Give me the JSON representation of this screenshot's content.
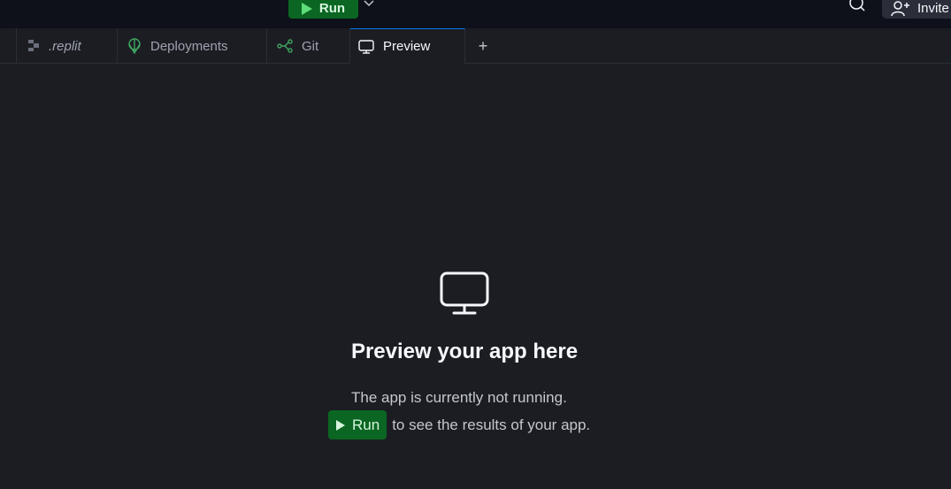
{
  "header": {
    "run_label": "Run",
    "invite_label": "Invite"
  },
  "tabs": [
    {
      "label": ".replit",
      "icon": "replit-file-icon"
    },
    {
      "label": "Deployments",
      "icon": "deployments-icon"
    },
    {
      "label": "Git",
      "icon": "git-icon"
    },
    {
      "label": "Preview",
      "icon": "monitor-icon",
      "active": true
    }
  ],
  "tab_add_label": "+",
  "empty_state": {
    "title": "Preview your app here",
    "line1": "The app is currently not running.",
    "run_label": "Run",
    "line2_suffix": "to see the results of your app."
  },
  "colors": {
    "accent_blue": "#0079f2",
    "run_green": "#0a6622",
    "background": "#1c1d23",
    "header_bg": "#0f111a"
  }
}
